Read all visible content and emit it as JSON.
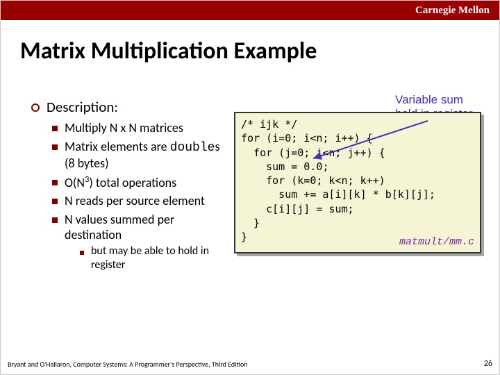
{
  "banner": {
    "org": "Carnegie Mellon"
  },
  "title": "Matrix Multiplication Example",
  "description": {
    "heading": "Description:",
    "items": [
      {
        "text": "Multiply N x N matrices"
      },
      {
        "text_pre": "Matrix elements are ",
        "mono": "double",
        "text_post": "s (8 bytes)"
      },
      {
        "text_pre": "O(N",
        "sup": "3",
        "text_post": ") total operations"
      },
      {
        "text": "N reads per source element"
      },
      {
        "text": "N values summed per destination",
        "children": [
          {
            "text": "but may be able to hold in register"
          }
        ]
      }
    ]
  },
  "callout": {
    "line1": "Variable sum",
    "line2": "held in register"
  },
  "code": {
    "lines": [
      "/* ijk */",
      "for (i=0; i<n; i++) {",
      "  for (j=0; j<n; j++) {",
      "    sum = 0.0;",
      "    for (k=0; k<n; k++)",
      "      sum += a[i][k] * b[k][j];",
      "    c[i][j] = sum;",
      "  }",
      "}"
    ],
    "source": "matmult/mm.c"
  },
  "footer": {
    "credit": "Bryant and O'Hallaron, Computer Systems: A Programmer's Perspective, Third Edition",
    "page": "26"
  }
}
